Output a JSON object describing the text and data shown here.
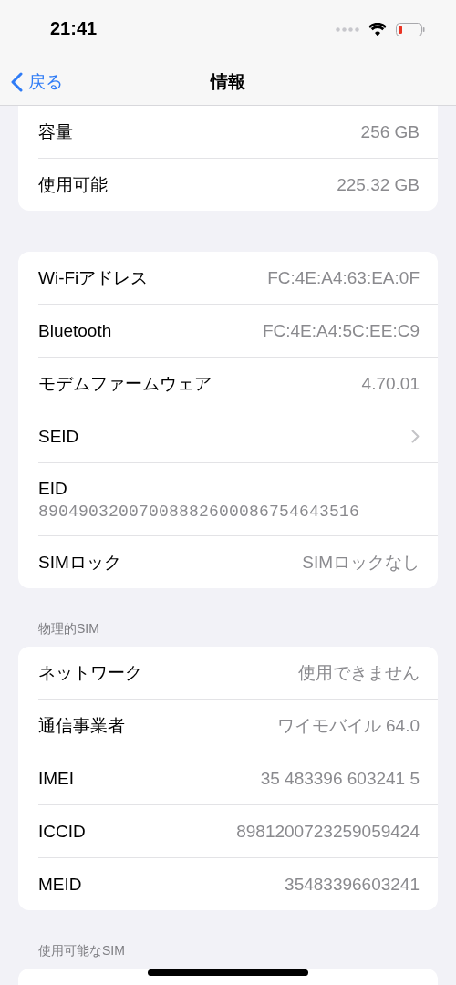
{
  "status_bar": {
    "time": "21:41"
  },
  "nav_bar": {
    "back": "戻る",
    "title": "情報"
  },
  "sections": [
    {
      "cut_top": true,
      "rows": [
        {
          "kind": "value",
          "label": "容量",
          "value": "256 GB"
        },
        {
          "kind": "value",
          "label": "使用可能",
          "value": "225.32 GB"
        }
      ]
    },
    {
      "rows": [
        {
          "kind": "value",
          "label": "Wi-Fiアドレス",
          "value": "FC:4E:A4:63:EA:0F"
        },
        {
          "kind": "value",
          "label": "Bluetooth",
          "value": "FC:4E:A4:5C:EE:C9"
        },
        {
          "kind": "value",
          "label": "モデムファームウェア",
          "value": "4.70.01"
        },
        {
          "kind": "disclosure",
          "label": "SEID"
        },
        {
          "kind": "stacked",
          "label": "EID",
          "value": "89049032007008882600086754643516"
        },
        {
          "kind": "value",
          "label": "SIMロック",
          "value": "SIMロックなし"
        }
      ]
    },
    {
      "header": "物理的SIM",
      "rows": [
        {
          "kind": "value",
          "label": "ネットワーク",
          "value": "使用できません"
        },
        {
          "kind": "value",
          "label": "通信事業者",
          "value": "ワイモバイル 64.0"
        },
        {
          "kind": "value",
          "label": "IMEI",
          "value": "35 483396 603241 5"
        },
        {
          "kind": "value",
          "label": "ICCID",
          "value": "8981200723259059424"
        },
        {
          "kind": "value",
          "label": "MEID",
          "value": "35483396603241"
        }
      ]
    },
    {
      "header": "使用可能なSIM"
    }
  ]
}
